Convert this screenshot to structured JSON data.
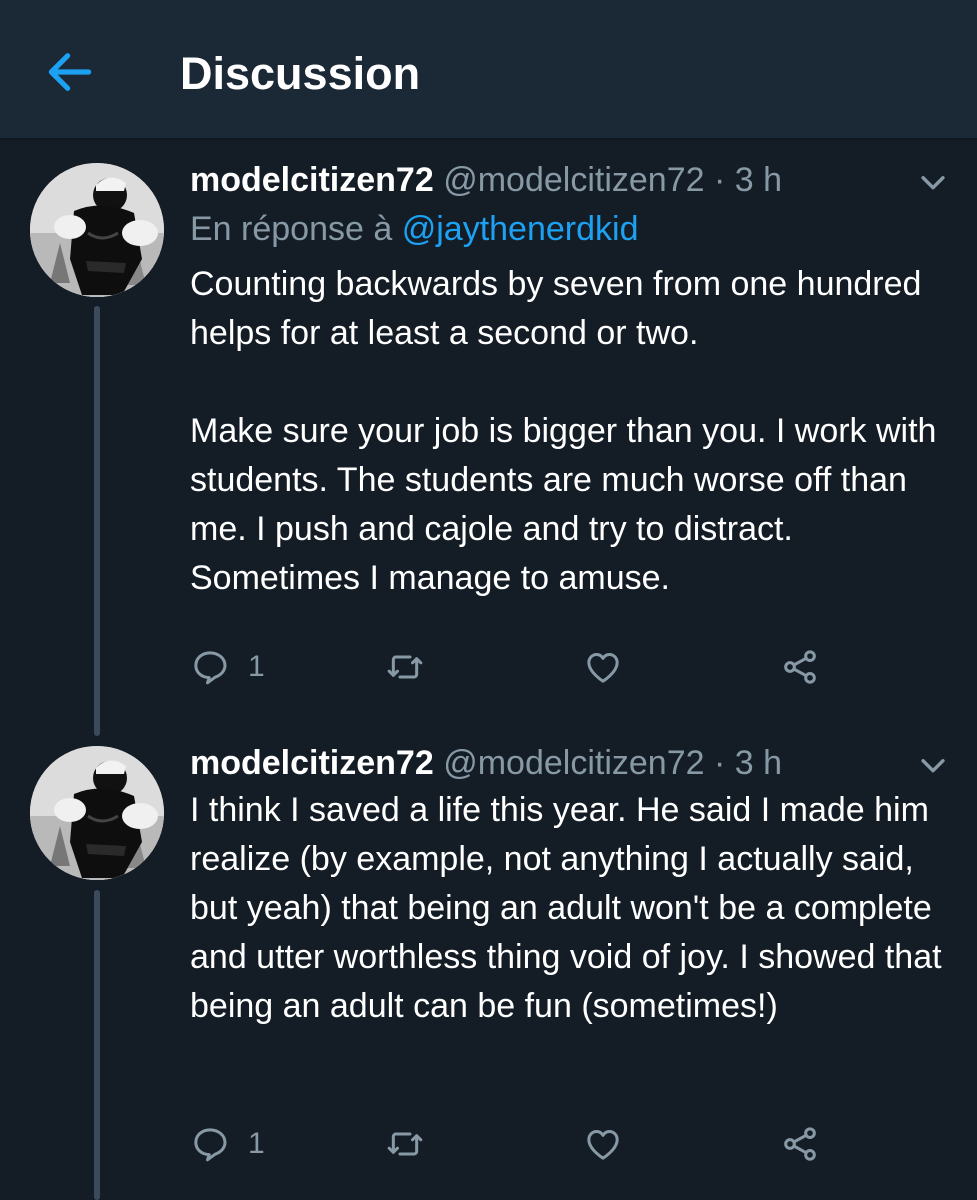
{
  "header": {
    "title": "Discussion",
    "back_icon": "arrow-left-icon",
    "accent_color": "#1da1f2"
  },
  "colors": {
    "background": "#141d26",
    "header_background": "#1b2836",
    "secondary_text": "#8899a6",
    "link": "#1da1f2"
  },
  "tweets": [
    {
      "display_name": "modelcitizen72",
      "handle": "@modelcitizen72",
      "separator": "·",
      "time": "3 h",
      "reply_prefix": "En réponse à",
      "reply_to": "@jaythenerdkid",
      "text": "Counting backwards by seven from one hundred helps for at least a second or two.\n\nMake sure your job is bigger than you. I work with students. The students are much worse off than me. I push and cajole and try to distract. Sometimes I manage to amuse.",
      "reply_count": "1",
      "icons": [
        "reply-icon",
        "retweet-icon",
        "like-icon",
        "share-icon",
        "chevron-down-icon"
      ]
    },
    {
      "display_name": "modelcitizen72",
      "handle": "@modelcitizen72",
      "separator": "·",
      "time": "3 h",
      "text": "I think I saved a life this year. He said I made him realize (by example, not anything I actually said, but yeah) that being an adult won't be a complete and utter worthless thing void of joy. I showed that being an adult can be fun (sometimes!)",
      "reply_count": "1",
      "icons": [
        "reply-icon",
        "retweet-icon",
        "like-icon",
        "share-icon",
        "chevron-down-icon"
      ]
    }
  ]
}
